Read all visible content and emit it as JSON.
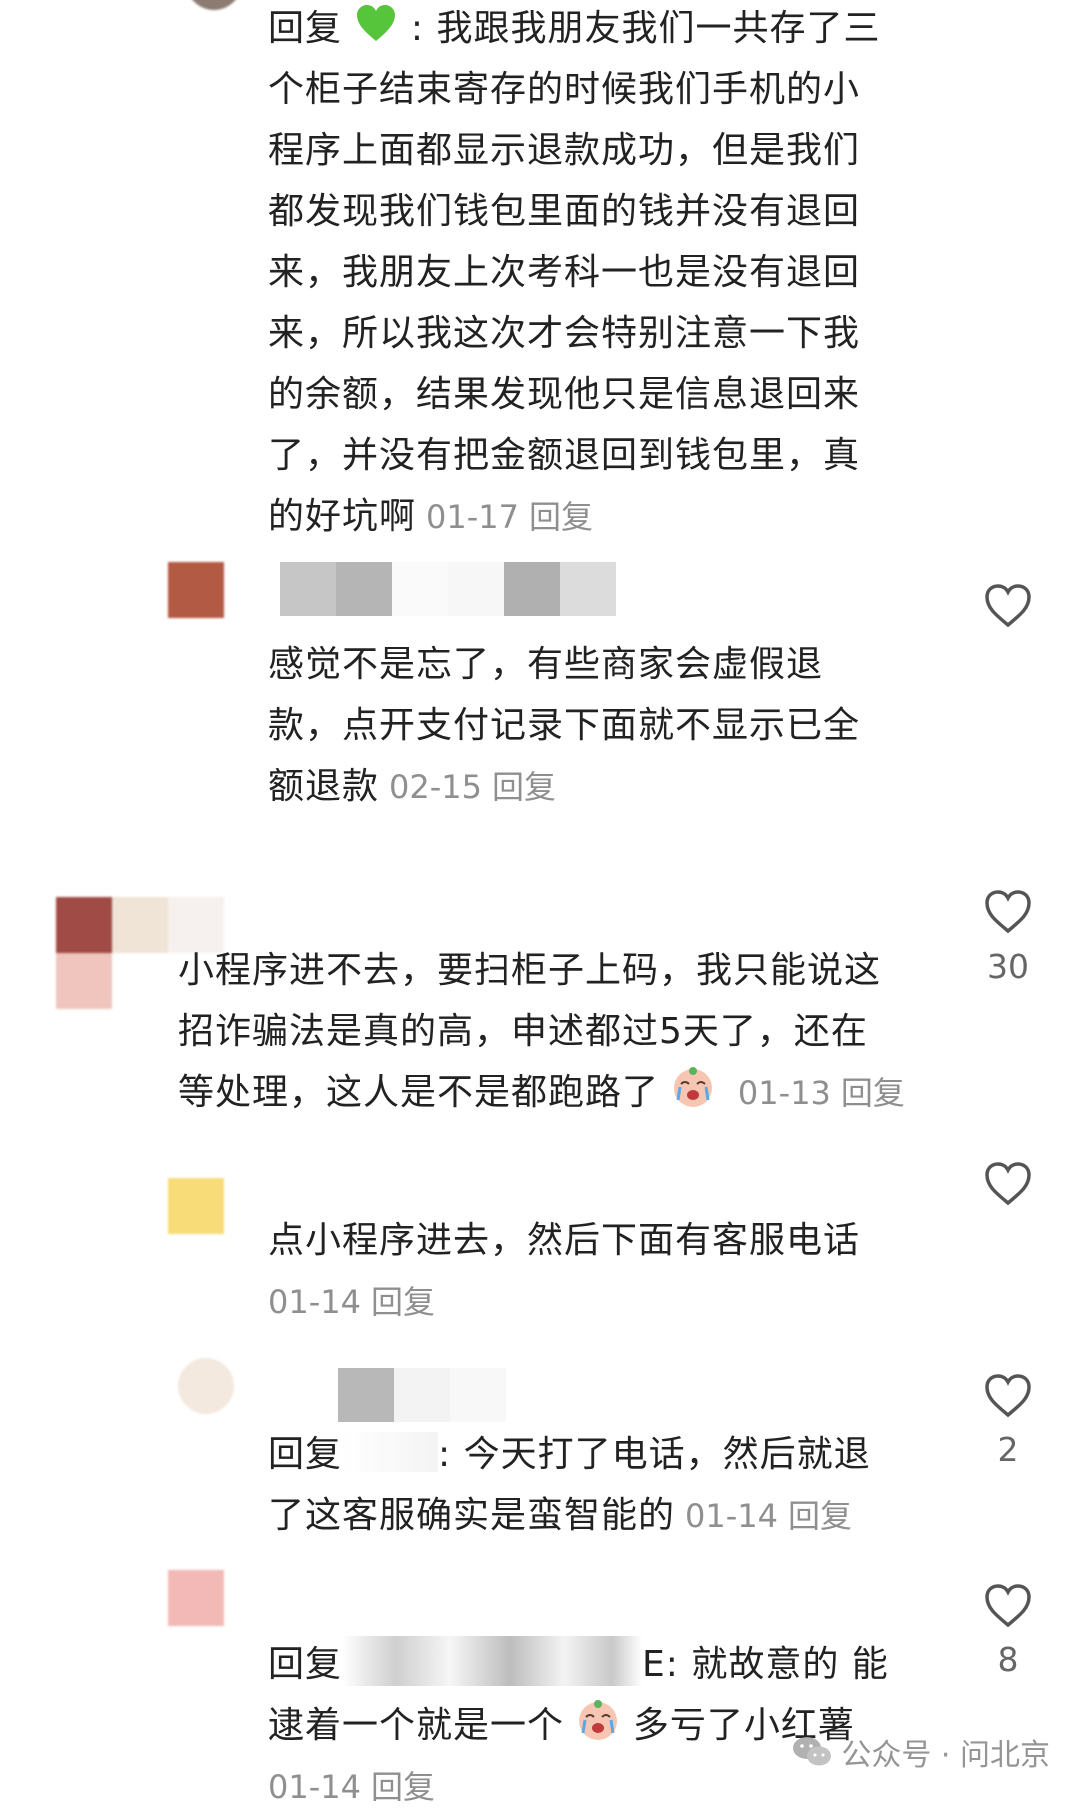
{
  "comments": [
    {
      "id": "c1",
      "prefix": "回复",
      "emoji": "green-heart-emoji",
      "separator": ":",
      "lines": [
        "我跟我朋友我们一共存了三",
        "个柜子结束寄存的时候我们手机的小",
        "程序上面都显示退款成功，但是我们",
        "都发现我们钱包里面的钱并没有退回",
        "来，我朋友上次考科一也是没有退回",
        "来，所以我这次才会特别注意一下我",
        "的余额，结果发现他只是信息退回来",
        "了，并没有把金额退回到钱包里，真",
        "的好坑啊"
      ],
      "date": "01-17",
      "reply_label": "回复"
    },
    {
      "id": "c2",
      "lines": [
        "感觉不是忘了，有些商家会虚假退",
        "款，点开支付记录下面就不显示已全",
        "额退款"
      ],
      "date": "02-15",
      "reply_label": "回复"
    },
    {
      "id": "c3",
      "lines": [
        "小程序进不去，要扫柜子上码，我只能说这",
        "招诈骗法是真的高，申述都过5天了，还在",
        "等处理，这人是不是都跑路了"
      ],
      "emoji": "crying-face-emoji",
      "date": "01-13",
      "reply_label": "回复",
      "likes": "30"
    },
    {
      "id": "c4",
      "lines": [
        "点小程序进去，然后下面有客服电话"
      ],
      "date": "01-14",
      "reply_label": "回复"
    },
    {
      "id": "c5",
      "prefix": "回复",
      "separator": ":",
      "lines": [
        "今天打了电话，然后就退",
        "了这客服确实是蛮智能的"
      ],
      "date": "01-14",
      "reply_label": "回复",
      "likes": "2"
    },
    {
      "id": "c6",
      "prefix": "回复",
      "separator": "E:",
      "lines": [
        "就故意的 能",
        "逮着一个就是一个",
        "多亏了小红薯"
      ],
      "emoji": "crying-face-emoji",
      "date": "01-14",
      "reply_label": "回复",
      "likes": "8"
    }
  ],
  "watermark": {
    "icon": "wechat-icon",
    "text": "公众号 · 问北京"
  },
  "colors": {
    "text": "#222222",
    "meta": "#8f8f8f",
    "heart_stroke": "#555555"
  }
}
